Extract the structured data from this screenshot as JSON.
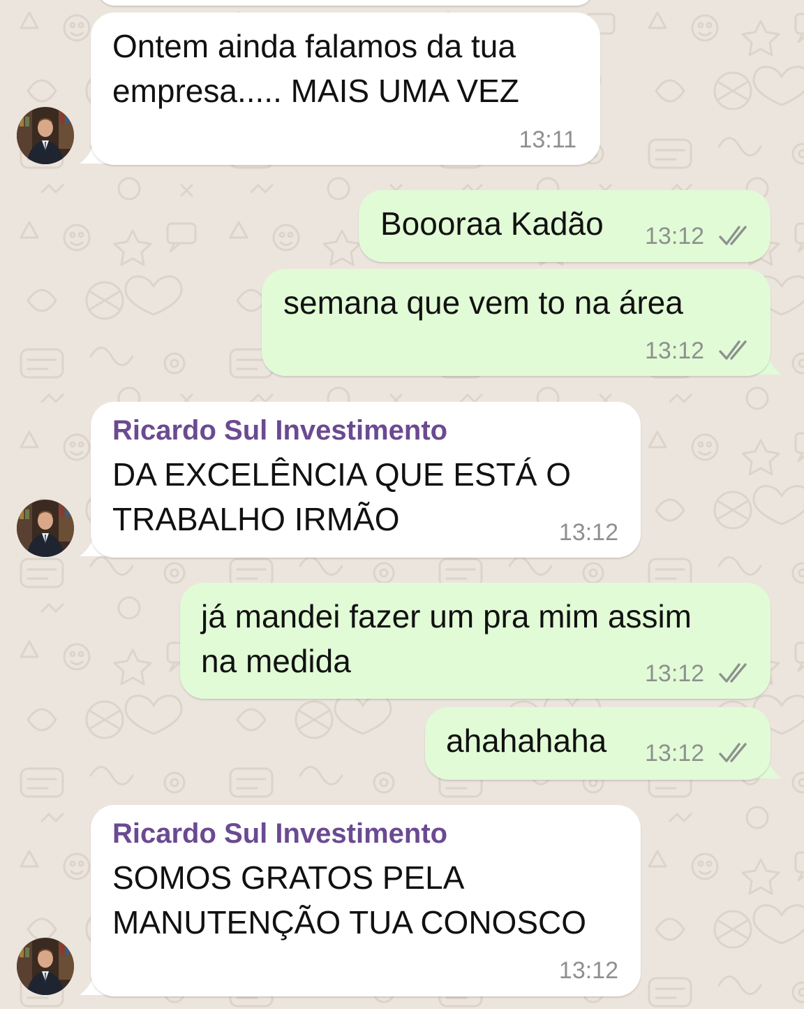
{
  "conversation": {
    "messages": [
      {
        "direction": "incoming",
        "sender": "",
        "text_lines": [
          "Ontem ainda falamos da tua",
          "empresa..... MAIS UMA VEZ"
        ],
        "time": "13:11"
      },
      {
        "direction": "outgoing",
        "text_lines": [
          "Boooraa Kadão"
        ],
        "time": "13:12",
        "status": "read"
      },
      {
        "direction": "outgoing",
        "text_lines": [
          "semana que vem to na área"
        ],
        "time": "13:12",
        "status": "read"
      },
      {
        "direction": "incoming",
        "sender": "Ricardo Sul Investimento",
        "text_lines": [
          "DA EXCELÊNCIA QUE ESTÁ O",
          "TRABALHO IRMÃO"
        ],
        "time": "13:12"
      },
      {
        "direction": "outgoing",
        "text_lines": [
          "já mandei fazer um pra mim assim",
          "na medida"
        ],
        "time": "13:12",
        "status": "read"
      },
      {
        "direction": "outgoing",
        "text_lines": [
          "ahahahaha"
        ],
        "time": "13:12",
        "status": "read"
      },
      {
        "direction": "incoming",
        "sender": "Ricardo Sul Investimento",
        "text_lines": [
          "SOMOS GRATOS PELA",
          "MANUTENÇÃO TUA CONOSCO"
        ],
        "time": "13:12"
      }
    ]
  },
  "colors": {
    "background": "#ECE5DD",
    "incoming_bubble": "#FFFFFF",
    "outgoing_bubble": "#E1FBD6",
    "sender_name": "#6B4A91",
    "timestamp": "#8D918E",
    "read_ticks": "#8D918E"
  },
  "icons": {
    "avatar": "contact-avatar-photo",
    "status": "double-check-icon"
  }
}
